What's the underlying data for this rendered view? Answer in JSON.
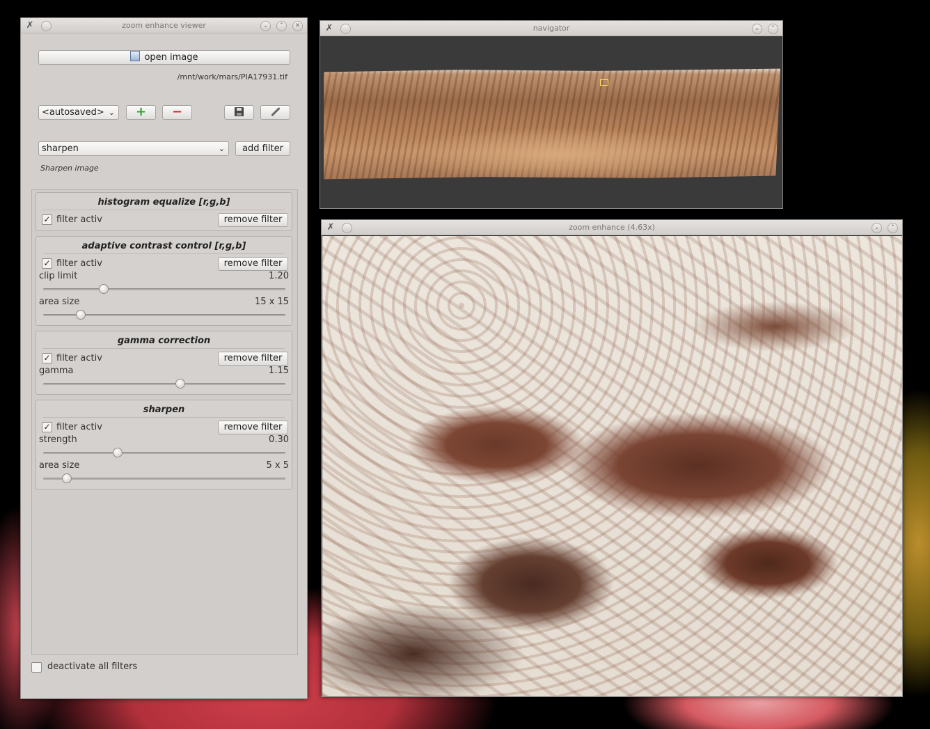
{
  "main_window": {
    "title": "zoom enhance viewer",
    "open_image_label": "open image",
    "file_path": "/mnt/work/mars/PIA17931.tif",
    "preset_selected": "<autosaved>",
    "add_preset_symbol": "+",
    "remove_preset_symbol": "−",
    "filter_type_selected": "sharpen",
    "add_filter_label": "add filter",
    "filter_description": "Sharpen image",
    "deactivate_all_label": "deactivate all filters",
    "filters": [
      {
        "title": "histogram equalize [r,g,b]",
        "active_label": "filter activ",
        "active": true,
        "remove_label": "remove filter"
      },
      {
        "title": "adaptive contrast control [r,g,b]",
        "active_label": "filter activ",
        "active": true,
        "remove_label": "remove filter",
        "params": [
          {
            "label": "clip limit",
            "value": "1.20",
            "level": 0.24
          },
          {
            "label": "area size",
            "value": "15 x 15",
            "level": 0.14
          }
        ]
      },
      {
        "title": "gamma correction",
        "active_label": "filter activ",
        "active": true,
        "remove_label": "remove filter",
        "params": [
          {
            "label": "gamma",
            "value": "1.15",
            "level": 0.57
          }
        ]
      },
      {
        "title": "sharpen",
        "active_label": "filter activ",
        "active": true,
        "remove_label": "remove filter",
        "params": [
          {
            "label": "strength",
            "value": "0.30",
            "level": 0.3
          },
          {
            "label": "area size",
            "value": "5 x 5",
            "level": 0.08
          }
        ]
      }
    ]
  },
  "navigator_window": {
    "title": "navigator"
  },
  "zoom_window": {
    "title": "zoom enhance (4.63x)"
  },
  "icons": {
    "app": "x-tools-icon",
    "checkmark": "✓",
    "minimize": "⌄",
    "maximize": "⌃",
    "close": "✕",
    "chevron": "⌄"
  },
  "colors": {
    "window_bg": "#d3cfcc",
    "add_green": "#2ea32e",
    "remove_red": "#d8242c"
  }
}
